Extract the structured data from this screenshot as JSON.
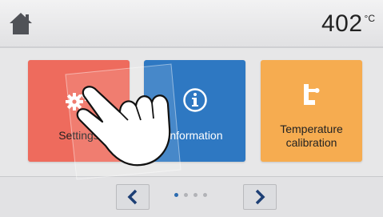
{
  "header": {
    "home_icon": "home-icon",
    "temperature": "402",
    "temperature_unit": "°C"
  },
  "tiles": [
    {
      "label": "Settings",
      "icon": "gear-icon",
      "color": "#ee6b5d"
    },
    {
      "label": "Information",
      "icon": "info-icon",
      "color": "#2e78c2"
    },
    {
      "label": "Temperature calibration",
      "icon": "calibration-icon",
      "color": "#f6ac50"
    }
  ],
  "footer": {
    "prev_icon": "chevron-left-icon",
    "next_icon": "chevron-right-icon",
    "page_count": 4,
    "current_page": 1
  },
  "overlay": {
    "icon": "hand-pointer-icon"
  }
}
